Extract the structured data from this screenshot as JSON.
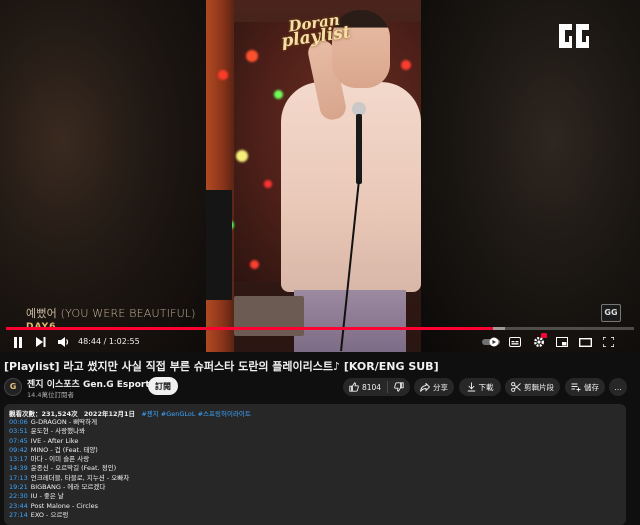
{
  "video": {
    "overlay_title_line1": "Doran",
    "overlay_title_line2": "playlist",
    "lyric": "예뻤어 (YOU WERE BEAUTIFUL)",
    "artist": "DAY6",
    "corner_logo": "GG",
    "time": "48:44 / 1:02:55",
    "progress_fraction": 0.775,
    "buffer_fraction": 0.795
  },
  "controls": {
    "play_icon": "pause-icon",
    "next_icon": "next-icon",
    "volume_icon": "volume-icon",
    "autoplay_icon": "autoplay-toggle-icon",
    "captions_icon": "captions-icon",
    "settings_icon": "settings-icon",
    "miniplayer_icon": "miniplayer-icon",
    "theater_icon": "theater-icon",
    "fullscreen_icon": "fullscreen-icon"
  },
  "title": "[Playlist] 라고 썼지만 사실 직접 부른 슈퍼스타 도란의 플레이리스트♪ [KOR/ENG SUB]",
  "channel": {
    "avatar_text": "G",
    "name": "젠지 이스포츠 Gen.G Esports",
    "subscribers": "14.4萬位訂閱者",
    "subscribe_label": "訂閱"
  },
  "actions": {
    "like_count": "8104",
    "share_label": "分享",
    "download_label": "下載",
    "clip_label": "剪輯片段",
    "save_label": "儲存",
    "more_label": "…"
  },
  "description": {
    "views": "觀看次數：231,524次",
    "date": "2022年12月1日",
    "tags": "#젠지 #GenGLoL #스프링허이라이트",
    "tracks": [
      {
        "time": "00:06",
        "song": "G-DRAGON - 삐딱하게"
      },
      {
        "time": "03:51",
        "song": "윤도현 - 사랑했나봐"
      },
      {
        "time": "07:45",
        "song": "IVE - After Like"
      },
      {
        "time": "09:42",
        "song": "MINO - 겁 (Feat. 태양)"
      },
      {
        "time": "13:17",
        "song": "마다 - 이미 슬픈 사랑"
      },
      {
        "time": "14:39",
        "song": "윤종신 - 오르막길 (Feat. 정인)"
      },
      {
        "time": "17:13",
        "song": "언크레더블, 타블로, 지누션 - 오빠차"
      },
      {
        "time": "19:21",
        "song": "BIGBANG - 에라 모르겠다"
      },
      {
        "time": "22:30",
        "song": "IU - 좋은 날"
      },
      {
        "time": "23:44",
        "song": "Post Malone - Circles"
      },
      {
        "time": "27:14",
        "song": "EXO - 으르렁"
      }
    ]
  },
  "colors": {
    "accent_red": "#ff0033",
    "link_blue": "#3ea6ff",
    "background": "#0f0f0f",
    "surface": "#272727"
  }
}
